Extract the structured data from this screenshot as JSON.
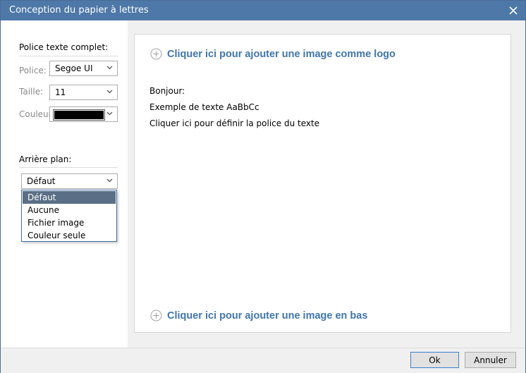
{
  "window": {
    "title": "Conception du papier à lettres"
  },
  "left": {
    "font_section_label": "Police texte complet:",
    "police_label": "Police:",
    "police_value": "Segoe UI",
    "taille_label": "Taille:",
    "taille_value": "11",
    "couleur_label": "Couleur:",
    "couleur_value": "#000000",
    "background_section_label": "Arrière plan:",
    "background_value": "Défaut",
    "background_options": [
      "Défaut",
      "Aucune",
      "Fichier image",
      "Couleur seule"
    ]
  },
  "preview": {
    "add_logo_label": "Cliquer ici pour ajouter une image comme logo",
    "greeting": "Bonjour:",
    "sample_text": "Exemple de texte  AaBbCc",
    "font_hint": "Cliquer ici pour définir la police du texte",
    "add_bottom_label": "Cliquer ici pour ajouter une image en bas"
  },
  "footer": {
    "ok_label": "Ok",
    "cancel_label": "Annuler"
  },
  "colors": {
    "titlebar": "#4d78a8",
    "link": "#3f75ad",
    "selected_item": "#5a6f85"
  }
}
